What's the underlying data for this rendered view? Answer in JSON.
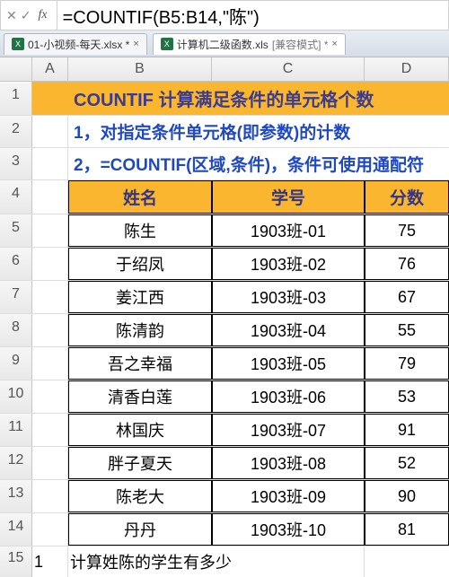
{
  "formula_bar": {
    "cancel_icon": "✕",
    "accept_icon": "✓",
    "fx_label": "fx",
    "formula": "=COUNTIF(B5:B14,\"陈\")"
  },
  "tabs": {
    "tab1": {
      "label": "01-小视频-每天.xlsx *"
    },
    "tab2": {
      "label": "计算机二级函数.xls",
      "compat": "[兼容模式] *"
    }
  },
  "columns": {
    "A": "A",
    "B": "B",
    "C": "C",
    "D": "D"
  },
  "rows": {
    "r1": "1",
    "r2": "2",
    "r3": "3",
    "r4": "4",
    "r5": "5",
    "r6": "6",
    "r7": "7",
    "r8": "8",
    "r9": "9",
    "r10": "10",
    "r11": "11",
    "r12": "12",
    "r13": "13",
    "r14": "14",
    "r15": "15"
  },
  "title": "COUNTIF 计算满足条件的单元格个数",
  "subtitle1": "1，对指定条件单元格(即参数)的计数",
  "subtitle2": "2，=COUNTIF(区域,条件)，条件可使用通配符",
  "headers": {
    "name": "姓名",
    "id": "学号",
    "score": "分数"
  },
  "data": [
    {
      "name": "陈生",
      "id": "1903班-01",
      "score": "75"
    },
    {
      "name": "于绍凤",
      "id": "1903班-02",
      "score": "76"
    },
    {
      "name": "姜江西",
      "id": "1903班-03",
      "score": "67"
    },
    {
      "name": "陈清韵",
      "id": "1903班-04",
      "score": "55"
    },
    {
      "name": "吾之幸福",
      "id": "1903班-05",
      "score": "79"
    },
    {
      "name": "清香白莲",
      "id": "1903班-06",
      "score": "53"
    },
    {
      "name": "林国庆",
      "id": "1903班-07",
      "score": "91"
    },
    {
      "name": "胖子夏天",
      "id": "1903班-08",
      "score": "52"
    },
    {
      "name": "陈老大",
      "id": "1903班-09",
      "score": "90"
    },
    {
      "name": "丹丹",
      "id": "1903班-10",
      "score": "81"
    }
  ],
  "row15_a": "1",
  "row15_text": "计算姓陈的学生有多少"
}
